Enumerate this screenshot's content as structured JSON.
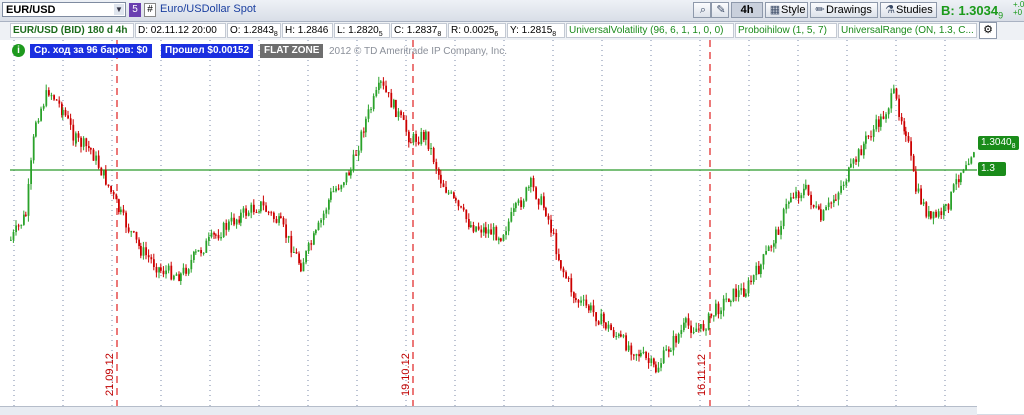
{
  "toolbar": {
    "symbol": "EUR/USD",
    "link_badge": "5",
    "hash_button": "#",
    "description": "Euro/USDollar Spot",
    "aggregation": "4h",
    "style_label": "Style",
    "drawings_label": "Drawings",
    "studies_label": "Studies",
    "bid_label": "B:",
    "bid_main": "1.3034",
    "bid_frac": "9",
    "change_top": "+.0",
    "change_bottom": "+0"
  },
  "infobar": {
    "instrument": "EUR/USD (BID) 180 d 4h",
    "date": "D: 02.11.12 20:00",
    "open": "O: 1.2843",
    "open_frac": "8",
    "high": "H: 1.2846",
    "low": "L: 1.2820",
    "low_frac": "5",
    "close": "C: 1.2837",
    "close_frac": "8",
    "range": "R: 0.0025",
    "range_frac": "6",
    "y": "Y: 1.2815",
    "y_frac": "8",
    "study1": "UniversalVolatility (96, 6, 1, 1, 0, 0)",
    "study2": "Proboihilow (1, 5, 7)",
    "study3": "UniversalRange (ON, 1.3, C..."
  },
  "chart_labels": {
    "avg_move": "Ср. ход за 96 баров: $0",
    "passed": "Прошел $0.00152",
    "flat_zone": "FLAT ZONE",
    "copyright": "2012 © TD Ameritrade IP Company, Inc.",
    "info_icon": "i",
    "date1": "21.09.12",
    "date2": "19.10.12",
    "date3": "16.11.12"
  },
  "price_tags": {
    "last_price": "1.3040",
    "last_price_frac": "8",
    "level": "1.3"
  },
  "colors": {
    "up_candle": "#2aa22a",
    "down_candle": "#cc0000",
    "level_line": "#2a9a2a",
    "date_line": "#e02020",
    "label_blue": "#1a2fe0",
    "label_gray": "#6e6e6e"
  }
}
